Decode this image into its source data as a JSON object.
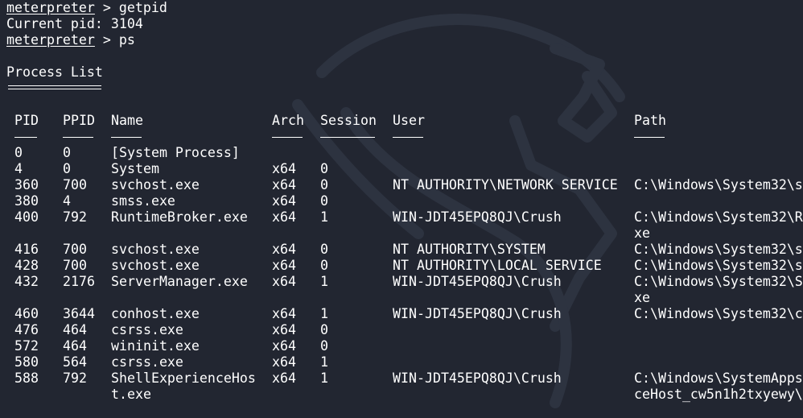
{
  "colors": {
    "background": "#222631",
    "text": "#ffffff"
  },
  "prompt": "meterpreter",
  "commands": {
    "getpid": "getpid",
    "ps": "ps",
    "symbol": ">"
  },
  "current_pid_line": "Current pid: 3104",
  "section_title": "Process List",
  "table": {
    "columns": [
      "PID",
      "PPID",
      "Name",
      "Arch",
      "Session",
      "User",
      "Path"
    ],
    "rows": [
      {
        "pid": "0",
        "ppid": "0",
        "name": "[System Process]",
        "name2": "",
        "arch": "",
        "session": "",
        "user": "",
        "path": "",
        "path2": ""
      },
      {
        "pid": "4",
        "ppid": "0",
        "name": "System",
        "name2": "",
        "arch": "x64",
        "session": "0",
        "user": "",
        "path": "",
        "path2": ""
      },
      {
        "pid": "360",
        "ppid": "700",
        "name": "svchost.exe",
        "name2": "",
        "arch": "x64",
        "session": "0",
        "user": "NT AUTHORITY\\NETWORK SERVICE",
        "path": "C:\\Windows\\System32\\s",
        "path2": ""
      },
      {
        "pid": "380",
        "ppid": "4",
        "name": "smss.exe",
        "name2": "",
        "arch": "x64",
        "session": "0",
        "user": "",
        "path": "",
        "path2": ""
      },
      {
        "pid": "400",
        "ppid": "792",
        "name": "RuntimeBroker.exe",
        "name2": "",
        "arch": "x64",
        "session": "1",
        "user": "WIN-JDT45EPQ8QJ\\Crush",
        "path": "C:\\Windows\\System32\\R",
        "path2": "xe"
      },
      {
        "pid": "416",
        "ppid": "700",
        "name": "svchost.exe",
        "name2": "",
        "arch": "x64",
        "session": "0",
        "user": "NT AUTHORITY\\SYSTEM",
        "path": "C:\\Windows\\System32\\s",
        "path2": ""
      },
      {
        "pid": "428",
        "ppid": "700",
        "name": "svchost.exe",
        "name2": "",
        "arch": "x64",
        "session": "0",
        "user": "NT AUTHORITY\\LOCAL SERVICE",
        "path": "C:\\Windows\\System32\\s",
        "path2": ""
      },
      {
        "pid": "432",
        "ppid": "2176",
        "name": "ServerManager.exe",
        "name2": "",
        "arch": "x64",
        "session": "1",
        "user": "WIN-JDT45EPQ8QJ\\Crush",
        "path": "C:\\Windows\\System32\\S",
        "path2": "xe"
      },
      {
        "pid": "460",
        "ppid": "3644",
        "name": "conhost.exe",
        "name2": "",
        "arch": "x64",
        "session": "1",
        "user": "WIN-JDT45EPQ8QJ\\Crush",
        "path": "C:\\Windows\\System32\\c",
        "path2": ""
      },
      {
        "pid": "476",
        "ppid": "464",
        "name": "csrss.exe",
        "name2": "",
        "arch": "x64",
        "session": "0",
        "user": "",
        "path": "",
        "path2": ""
      },
      {
        "pid": "572",
        "ppid": "464",
        "name": "wininit.exe",
        "name2": "",
        "arch": "x64",
        "session": "0",
        "user": "",
        "path": "",
        "path2": ""
      },
      {
        "pid": "580",
        "ppid": "564",
        "name": "csrss.exe",
        "name2": "",
        "arch": "x64",
        "session": "1",
        "user": "",
        "path": "",
        "path2": ""
      },
      {
        "pid": "588",
        "ppid": "792",
        "name": "ShellExperienceHos",
        "name2": "t.exe",
        "arch": "x64",
        "session": "1",
        "user": "WIN-JDT45EPQ8QJ\\Crush",
        "path": "C:\\Windows\\SystemApps",
        "path2": "ceHost_cw5n1h2txyewy\\"
      }
    ]
  }
}
